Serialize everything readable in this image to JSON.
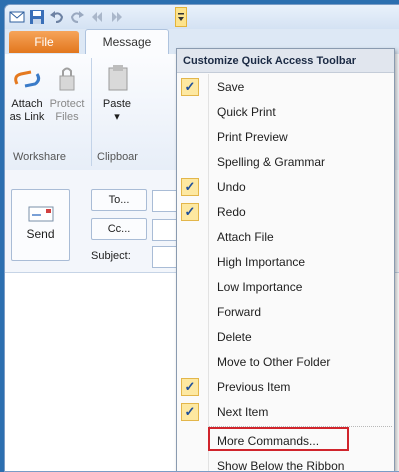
{
  "quick_access": {
    "icons": [
      "outlook-app-icon",
      "save-icon",
      "undo-icon",
      "redo-icon",
      "previous-item-icon",
      "next-item-icon",
      "customize-dropdown-icon"
    ]
  },
  "tabs": {
    "file": "File",
    "message": "Message"
  },
  "ribbon": {
    "attach_link_line1": "Attach",
    "attach_link_line2": "as Link",
    "protect_files_line1": "Protect",
    "protect_files_line2": "Files",
    "paste_label": "Paste",
    "group_workshare": "Workshare",
    "group_clipboard": "Clipboar"
  },
  "compose": {
    "send": "Send",
    "to": "To...",
    "cc": "Cc...",
    "subject": "Subject:"
  },
  "menu": {
    "title": "Customize Quick Access Toolbar",
    "items": [
      {
        "label": "Save",
        "checked": true
      },
      {
        "label": "Quick Print",
        "checked": false
      },
      {
        "label": "Print Preview",
        "checked": false
      },
      {
        "label": "Spelling & Grammar",
        "checked": false
      },
      {
        "label": "Undo",
        "checked": true
      },
      {
        "label": "Redo",
        "checked": true
      },
      {
        "label": "Attach File",
        "checked": false
      },
      {
        "label": "High Importance",
        "checked": false
      },
      {
        "label": "Low Importance",
        "checked": false
      },
      {
        "label": "Forward",
        "checked": false
      },
      {
        "label": "Delete",
        "checked": false
      },
      {
        "label": "Move to Other Folder",
        "checked": false
      },
      {
        "label": "Previous Item",
        "checked": true
      },
      {
        "label": "Next Item",
        "checked": true
      },
      {
        "label": "More Commands...",
        "checked": false
      },
      {
        "label": "Show Below the Ribbon",
        "checked": false
      }
    ],
    "check_glyph": "✓"
  },
  "colors": {
    "file_tab": "#e2771d",
    "check_bg": "#fde8a1",
    "highlight_border": "#d0242c"
  }
}
